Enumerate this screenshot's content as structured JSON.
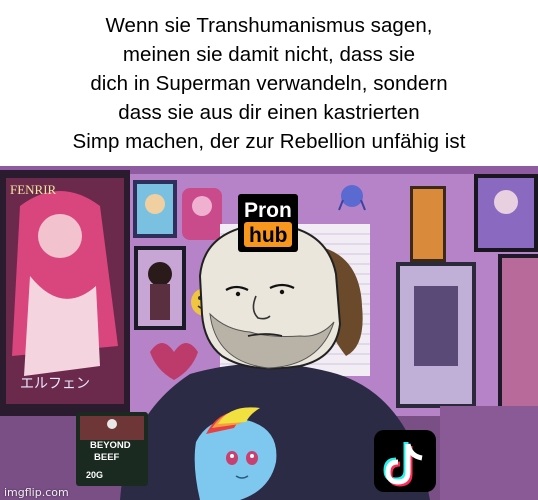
{
  "caption": {
    "lines": [
      "Wenn sie Transhumanismus sagen,",
      "meinen sie damit nicht, dass sie",
      "dich in Superman verwandeln, sondern",
      "dass sie aus dir einen kastrierten",
      "Simp machen, der zur Rebellion unfähig ist"
    ]
  },
  "stickers": {
    "pron_top": "Pron",
    "pron_bottom": "hub",
    "package_brand": "BEYOND",
    "package_product": "BEEF",
    "package_weight": "20G",
    "poster_corner": "FENRIR"
  },
  "icons": {
    "tiktok": "tiktok-logo-icon",
    "smiley": "smiley-face-icon"
  },
  "watermark": "imgflip.com",
  "colors": {
    "wall": "#b783c8",
    "pron_orange": "#f7971d",
    "shirt": "#2b2b45"
  }
}
